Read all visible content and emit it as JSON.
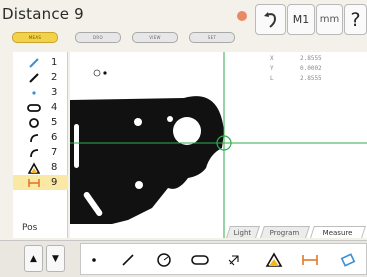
{
  "header": {
    "title": "Distance 9",
    "m1_label": "M1",
    "unit_label": "mm",
    "help_label": "?"
  },
  "mode_tabs": [
    {
      "label": "MEAS",
      "active": true
    },
    {
      "label": "DRO",
      "active": false
    },
    {
      "label": "VIEW",
      "active": false
    },
    {
      "label": "SET",
      "active": false
    }
  ],
  "features": [
    {
      "num": "1",
      "icon": "line-icon"
    },
    {
      "num": "2",
      "icon": "line-icon"
    },
    {
      "num": "3",
      "icon": "point-icon"
    },
    {
      "num": "4",
      "icon": "slot-icon"
    },
    {
      "num": "5",
      "icon": "circle-icon"
    },
    {
      "num": "6",
      "icon": "arc-icon"
    },
    {
      "num": "7",
      "icon": "arc-icon"
    },
    {
      "num": "8",
      "icon": "angle-icon"
    },
    {
      "num": "9",
      "icon": "distance-icon"
    }
  ],
  "selected_feature": "9",
  "pos_label": "Pos",
  "readout": {
    "x_label": "X",
    "x_value": "2.8555",
    "y_label": "Y",
    "y_value": "0.0002",
    "l_label": "L",
    "l_value": "2.8555"
  },
  "bottom_tabs": [
    {
      "label": "Light",
      "active": false
    },
    {
      "label": "Program",
      "active": false
    },
    {
      "label": "Measure",
      "active": true
    }
  ],
  "tools": [
    "point-tool-icon",
    "line-tool-icon",
    "circle-tool-icon",
    "slot-tool-icon",
    "custom-tool-icon",
    "angle-tool-icon",
    "distance-tool-icon",
    "rectangle-tool-icon"
  ],
  "colors": {
    "accent_yellow": "#f2d24a",
    "crosshair_green": "#2fae4a",
    "feature_blue": "#3a8fd6",
    "status_dot": "#e98a66"
  }
}
